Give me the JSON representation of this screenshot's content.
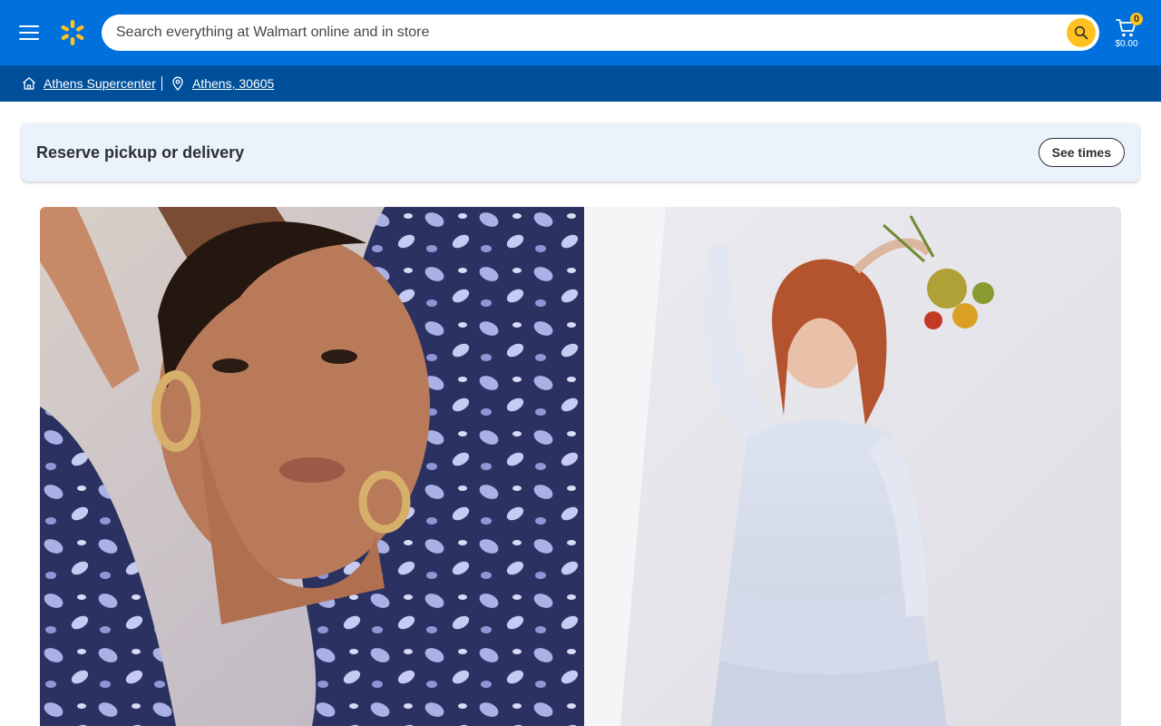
{
  "header": {
    "search": {
      "placeholder": "Search everything at Walmart online and in store"
    },
    "cart": {
      "count": "0",
      "total": "$0.00"
    }
  },
  "store_bar": {
    "store_name": "Athens Supercenter",
    "location": "Athens, 30605"
  },
  "reserve": {
    "title": "Reserve pickup or delivery",
    "button_label": "See times"
  },
  "colors": {
    "brand_blue": "#0071dc",
    "store_bar_blue": "#004f9a",
    "spark_yellow": "#ffc220",
    "reserve_bg": "#eaf2fb"
  },
  "icons": [
    "menu-icon",
    "walmart-spark-icon",
    "search-icon",
    "cart-icon",
    "store-icon",
    "location-pin-icon"
  ]
}
